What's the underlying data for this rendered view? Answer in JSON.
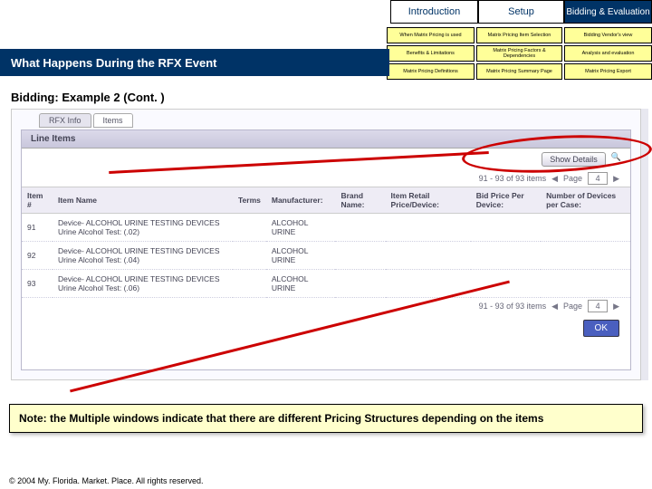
{
  "tabs": {
    "intro": "Introduction",
    "setup": "Setup",
    "bid": "Bidding & Evaluation"
  },
  "grid": [
    [
      "When Matrix Pricing is used",
      "Matrix Pricing Item Selection",
      "Bidding Vendor's view"
    ],
    [
      "Benefits & Limitations",
      "Matrix Pricing Factors & Dependencies",
      "Analysis and evaluation"
    ],
    [
      "Matrix Pricing Definitions",
      "Matrix Pricing Summary Page",
      "Matrix Pricing Export"
    ]
  ],
  "title": "What Happens During the RFX Event",
  "subtitle": "Bidding: Example 2 (Cont. )",
  "ss": {
    "tabs": [
      "RFX Info",
      "Items"
    ],
    "panel_title": "Line Items",
    "show_details": "Show Details",
    "range": "91 - 93 of 93 items",
    "page_label": "Page",
    "page_value": "4",
    "headers": [
      "Item #",
      "Item Name",
      "Terms",
      "Manufacturer:",
      "Brand Name:",
      "Item Retail Price/Device:",
      "Bid Price Per Device:",
      "Number of Devices per Case:"
    ],
    "rows": [
      {
        "num": "91",
        "name": "Device- ALCOHOL URINE TESTING DEVICES Urine Alcohol Test: (.02)",
        "terms": "",
        "mfr": "ALCOHOL URINE"
      },
      {
        "num": "92",
        "name": "Device- ALCOHOL URINE TESTING DEVICES Urine Alcohol Test: (.04)",
        "terms": "",
        "mfr": "ALCOHOL URINE"
      },
      {
        "num": "93",
        "name": "Device- ALCOHOL URINE TESTING DEVICES Urine Alcohol Test: (.06)",
        "terms": "",
        "mfr": "ALCOHOL URINE"
      }
    ],
    "ok": "OK"
  },
  "note": "Note: the Multiple windows indicate that there are different Pricing Structures depending on the items",
  "footer": "© 2004 My. Florida. Market. Place. All rights reserved."
}
